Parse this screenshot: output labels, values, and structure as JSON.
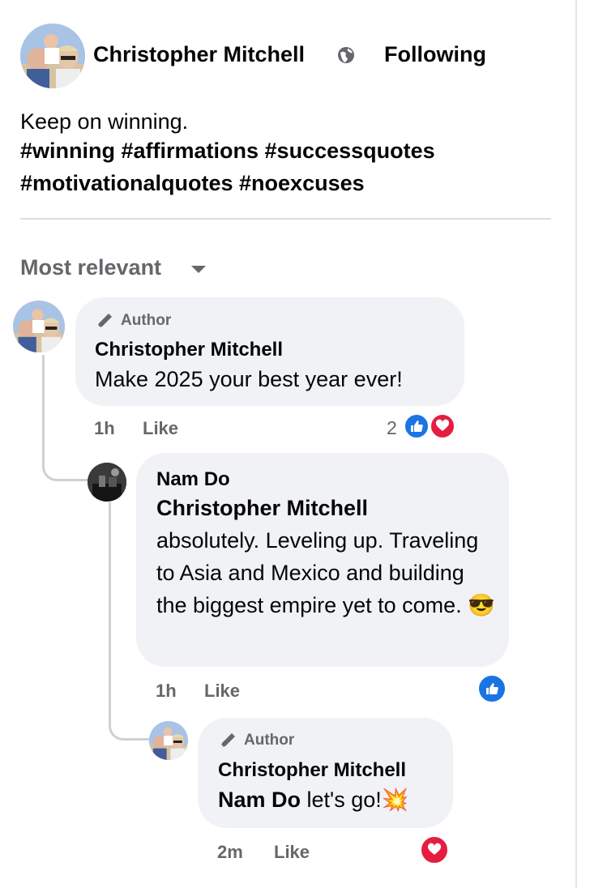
{
  "post": {
    "author": "Christopher Mitchell",
    "follow_label": "Following",
    "text": "Keep on winning.",
    "hashtags": "#winning #affirmations #successquotes #motivationalquotes #noexcuses",
    "privacy_icon": "globe-icon"
  },
  "sort": {
    "label": "Most relevant",
    "icon": "caret-down-icon"
  },
  "comments": [
    {
      "badge": "Author",
      "name": "Christopher Mitchell",
      "text": "Make 2025 your best year ever!",
      "time": "1h",
      "like_label": "Like",
      "reaction_count": "2",
      "reactions": [
        "like",
        "love"
      ]
    },
    {
      "name": "Nam Do",
      "mention": "Christopher Mitchell",
      "text": "absolutely. Leveling up. Traveling to Asia and Mexico and building the biggest empire yet to come. 😎",
      "time": "1h",
      "like_label": "Like",
      "reactions": [
        "like"
      ]
    },
    {
      "badge": "Author",
      "name": "Christopher Mitchell",
      "mention": "Nam Do",
      "text": " let's go!💥",
      "time": "2m",
      "like_label": "Like",
      "reactions": [
        "love"
      ]
    }
  ],
  "colors": {
    "like": "#1b74e4",
    "love": "#e41e3f",
    "bubble": "#f0f2f5",
    "muted": "#65676b"
  }
}
